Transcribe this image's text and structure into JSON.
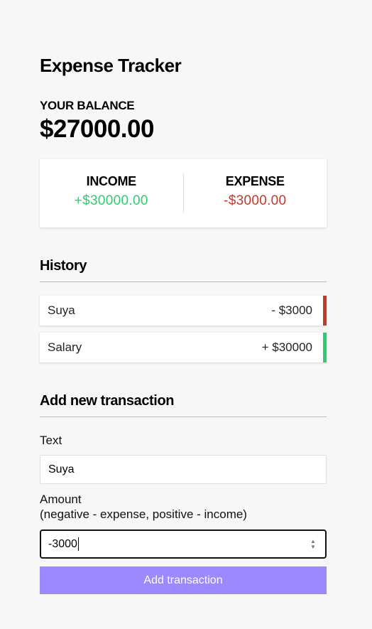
{
  "app": {
    "title": "Expense Tracker"
  },
  "balance": {
    "label": "YOUR BALANCE",
    "value": "$27000.00"
  },
  "summary": {
    "income_label": "INCOME",
    "income_value": "+$30000.00",
    "expense_label": "EXPENSE",
    "expense_value": "-$3000.00"
  },
  "history": {
    "title": "History",
    "items": [
      {
        "text": "Suya",
        "amount": "- $3000",
        "type": "expense"
      },
      {
        "text": "Salary",
        "amount": "+ $30000",
        "type": "income"
      }
    ]
  },
  "form": {
    "title": "Add new transaction",
    "text_label": "Text",
    "text_value": "Suya",
    "amount_label": "Amount",
    "amount_hint": "(negative - expense, positive - income)",
    "amount_value": "-3000",
    "submit_label": "Add transaction"
  },
  "colors": {
    "background": "#f7f7f7",
    "income": "#2ecc71",
    "expense": "#c0392b",
    "button": "#9c88ff"
  },
  "icons": {
    "spinner": "number-spinner-icon"
  }
}
